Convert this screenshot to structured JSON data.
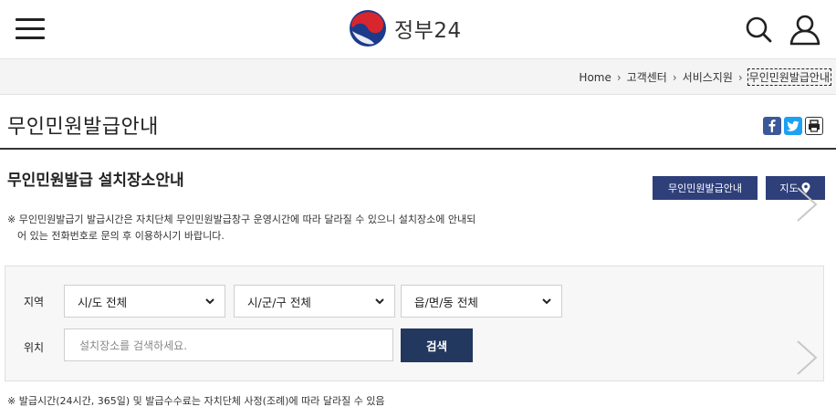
{
  "header": {
    "logo_text": "정부24",
    "icons": [
      "menu-icon",
      "search-icon",
      "user-icon"
    ]
  },
  "breadcrumb": {
    "items": [
      "Home",
      "고객센터",
      "서비스지원",
      "무인민원발급안내"
    ],
    "separator": "›"
  },
  "page": {
    "title": "무인민원발급안내",
    "share": [
      "facebook-icon",
      "twitter-icon",
      "print-icon"
    ]
  },
  "section": {
    "title": "무인민원발급 설치장소안내",
    "guide_button": "무인민원발급안내",
    "map_button": "지도",
    "notice_line1": "※ 무인민원발급기 발급시간은 자치단체 무인민원발급창구 운영시간에 따라 달라질 수 있으니 설치장소에 안내되",
    "notice_line2": "어 있는 전화번호로 문의 후 이용하시기 바랍니다."
  },
  "search": {
    "region_label": "지역",
    "select_sido": "시/도 전체",
    "select_sigungu": "시/군/구 전체",
    "select_eupmyeondong": "읍/면/동 전체",
    "location_label": "위치",
    "location_placeholder": "설치장소를 검색하세요.",
    "search_button": "검색"
  },
  "footnote": "※ 발급시간(24시간, 365일) 및 발급수수료는 자치단체 사정(조례)에 따라 달라질 수 있음",
  "colors": {
    "navy_button": "#2e3f7a",
    "search_button": "#23385f",
    "facebook": "#3b5998",
    "twitter": "#1da1f2"
  }
}
